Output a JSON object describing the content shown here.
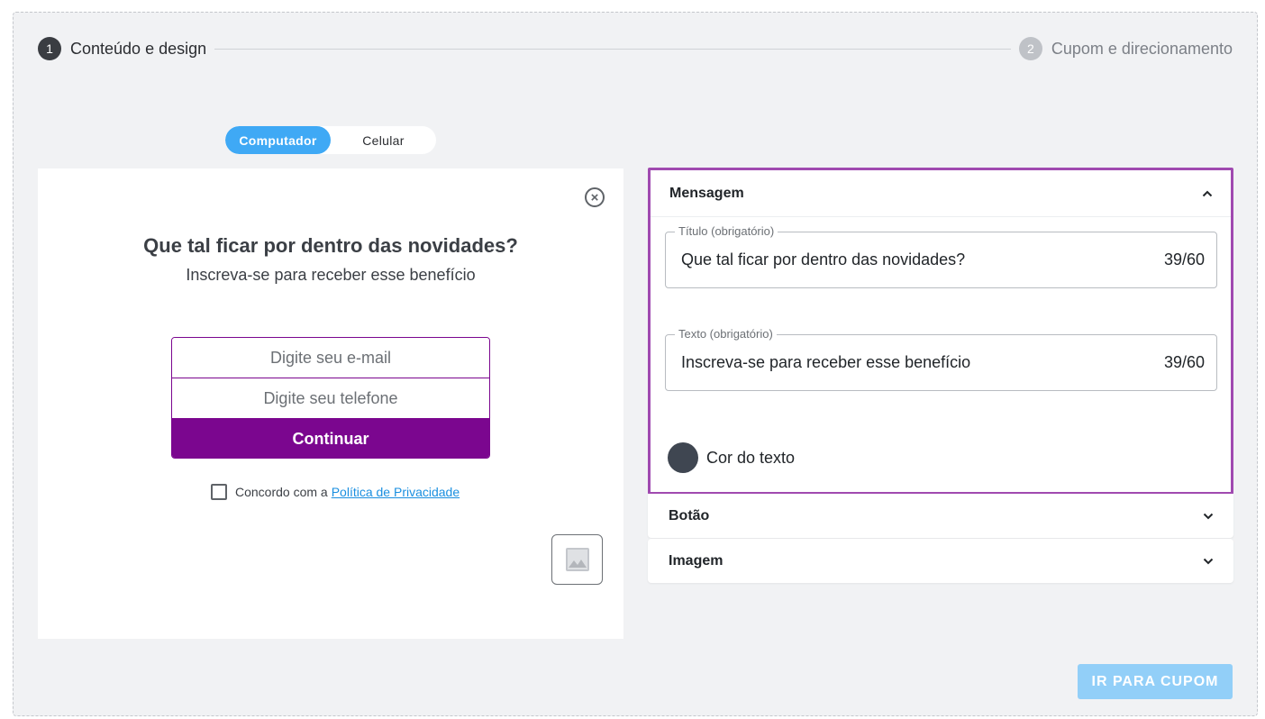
{
  "stepper": {
    "steps": [
      {
        "number": "1",
        "label": "Conteúdo e design"
      },
      {
        "number": "2",
        "label": "Cupom e direcionamento"
      }
    ]
  },
  "device_toggle": {
    "options": [
      "Computador",
      "Celular"
    ],
    "selected": "Computador"
  },
  "preview": {
    "close_icon": "close-circle-icon",
    "title": "Que tal ficar por dentro das novidades?",
    "subtitle": "Inscreva-se para receber esse benefício",
    "email_placeholder": "Digite seu e-mail",
    "phone_placeholder": "Digite seu telefone",
    "submit_label": "Continuar",
    "consent_text": "Concordo com a",
    "consent_link": "Política de Privacidade",
    "image_icon": "image-icon",
    "brand_color": "#7b068f"
  },
  "settings": {
    "mensagem": {
      "title": "Mensagem",
      "expanded": true,
      "titulo_field": {
        "legend": "Título (obrigatório)",
        "value": "Que tal ficar por dentro das novidades?",
        "counter": "39/60"
      },
      "texto_field": {
        "legend": "Texto (obrigatório)",
        "value": "Inscreva-se para receber esse benefício",
        "counter": "39/60"
      },
      "text_color_label": "Cor do texto",
      "text_color": "#3f4651"
    },
    "botao": {
      "title": "Botão",
      "expanded": false
    },
    "imagem": {
      "title": "Imagem",
      "expanded": false
    }
  },
  "footer": {
    "next_label": "IR PARA CUPOM",
    "next_color": "#92cff8"
  }
}
